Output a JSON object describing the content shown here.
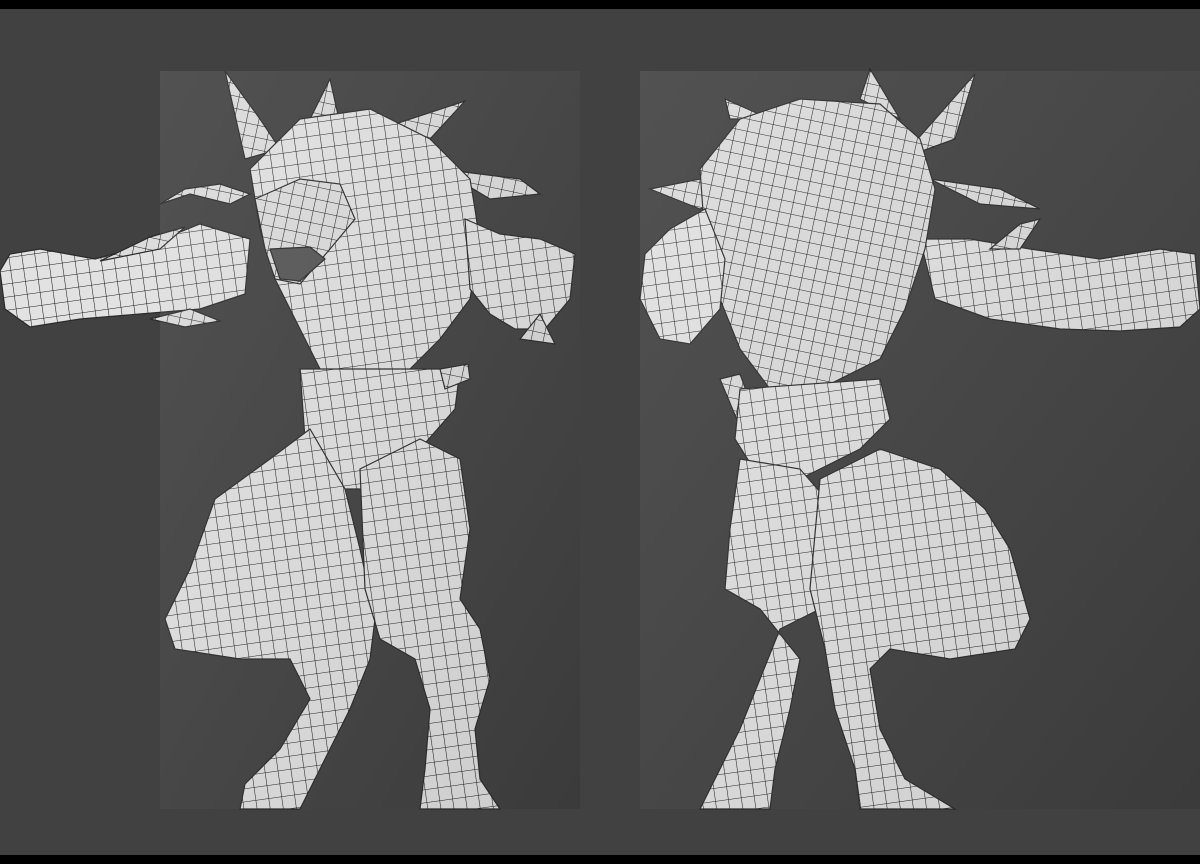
{
  "scene": {
    "background_color": "#414141",
    "border_color": "#000000",
    "mesh_fill_color": "#dedede",
    "mesh_wire_color": "#1c1c1c",
    "mesh_shadow_color": "#9a9a9a"
  },
  "models": [
    {
      "name": "creature-front-view",
      "view": "front",
      "icon": "wireframe-mesh"
    },
    {
      "name": "creature-back-view",
      "view": "back",
      "icon": "wireframe-mesh"
    }
  ]
}
